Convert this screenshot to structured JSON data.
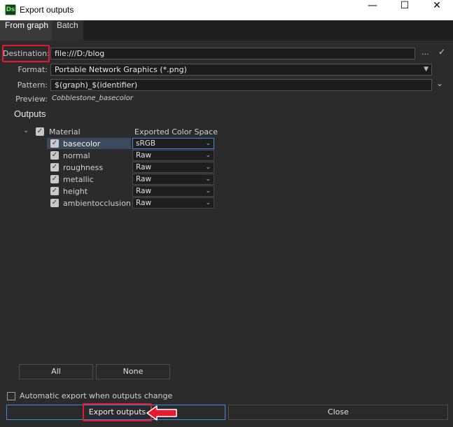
{
  "window": {
    "title": "Export outputs",
    "app_badge": "Ds",
    "minimize": "—",
    "maximize": "☐",
    "close": "✕"
  },
  "tabs": [
    {
      "label": "From graph"
    },
    {
      "label": "Batch"
    }
  ],
  "destination": {
    "label": "Destination:",
    "value": "file:///D:/blog",
    "browse": "...",
    "confirm": "✓"
  },
  "format": {
    "label": "Format:",
    "value": "Portable Network Graphics (*.png)"
  },
  "pattern": {
    "label": "Pattern:",
    "value": "$(graph)_$(identifier)"
  },
  "preview": {
    "label": "Preview:",
    "value": "Cobblestone_basecolor"
  },
  "outputs": {
    "title": "Outputs",
    "group": "Material",
    "column_header": "Exported Color Space",
    "rows": [
      {
        "name": "basecolor",
        "color_space": "sRGB"
      },
      {
        "name": "normal",
        "color_space": "Raw"
      },
      {
        "name": "roughness",
        "color_space": "Raw"
      },
      {
        "name": "metallic",
        "color_space": "Raw"
      },
      {
        "name": "height",
        "color_space": "Raw"
      },
      {
        "name": "ambientocclusion",
        "color_space": "Raw"
      }
    ]
  },
  "buttons": {
    "all": "All",
    "none": "None",
    "export": "Export outputs",
    "close": "Close"
  },
  "auto_export": {
    "label": "Automatic export when outputs change",
    "checked": false
  },
  "colors": {
    "highlight": "#e6192e",
    "accent": "#3c8ce7",
    "background": "#2b2b2b"
  }
}
